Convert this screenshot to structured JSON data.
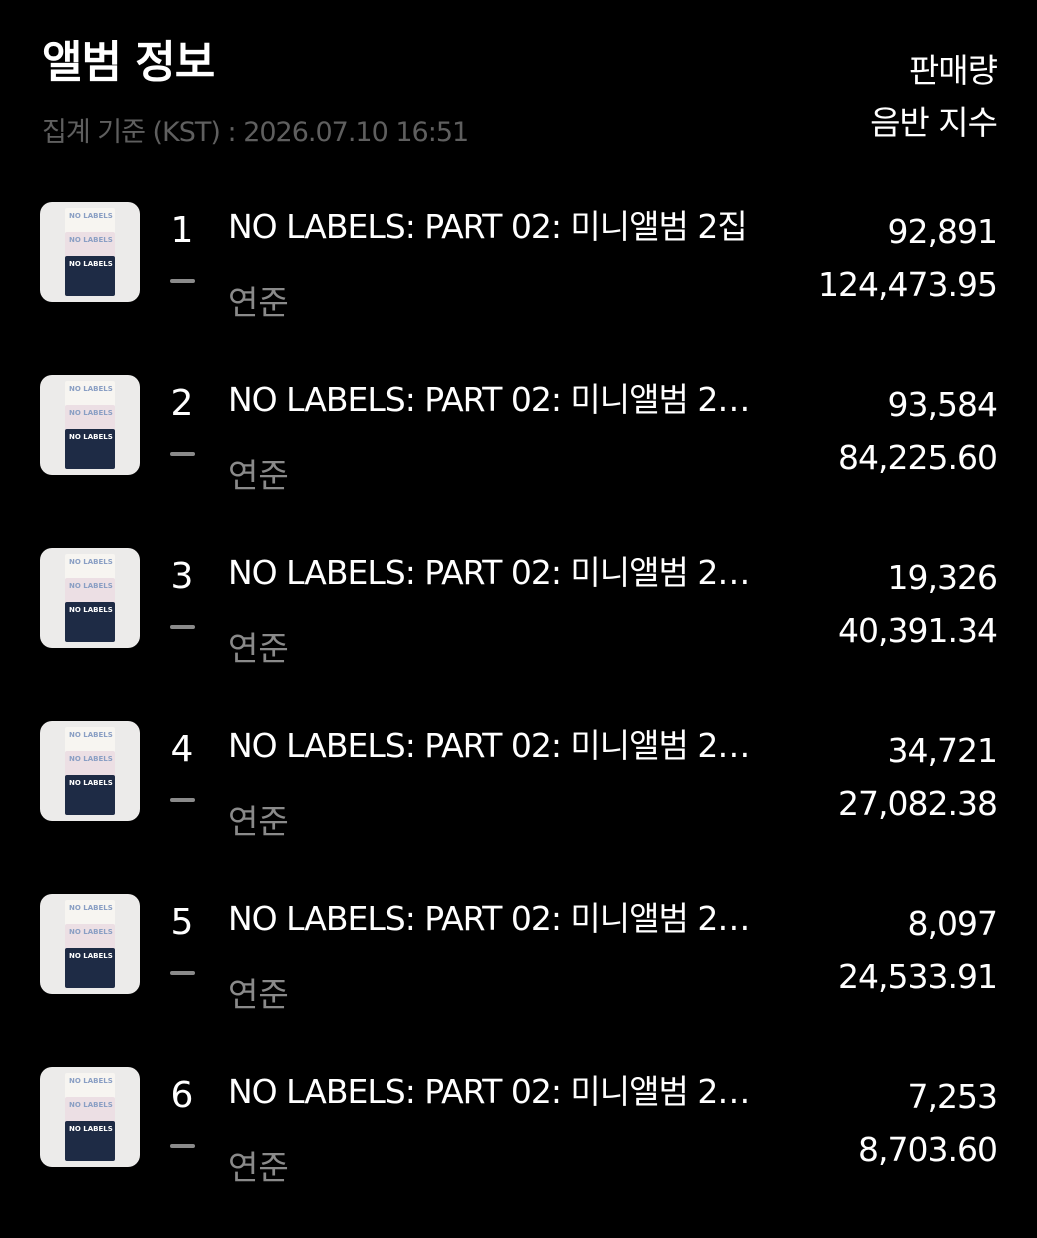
{
  "header": {
    "title": "앨범 정보",
    "updated_at": "집계 기준 (KST) : 2026.07.10 16:51",
    "col_sales": "판매량",
    "col_index": "음반 지수"
  },
  "rows": [
    {
      "rank": "1",
      "change_icon": "dash-icon",
      "title": "NO LABELS: PART 02: 미니앨범 2집",
      "artist": "연준",
      "sales": "92,891",
      "index": "124,473.95",
      "cover_text": "NO LABELS"
    },
    {
      "rank": "2",
      "change_icon": "dash-icon",
      "title": "NO LABELS: PART 02: 미니앨범 2…",
      "artist": "연준",
      "sales": "93,584",
      "index": "84,225.60",
      "cover_text": "NO LABELS"
    },
    {
      "rank": "3",
      "change_icon": "dash-icon",
      "title": "NO LABELS: PART 02: 미니앨범 2…",
      "artist": "연준",
      "sales": "19,326",
      "index": "40,391.34",
      "cover_text": "NO LABELS"
    },
    {
      "rank": "4",
      "change_icon": "dash-icon",
      "title": "NO LABELS: PART 02: 미니앨범 2…",
      "artist": "연준",
      "sales": "34,721",
      "index": "27,082.38",
      "cover_text": "NO LABELS"
    },
    {
      "rank": "5",
      "change_icon": "dash-icon",
      "title": "NO LABELS: PART 02: 미니앨범 2…",
      "artist": "연준",
      "sales": "8,097",
      "index": "24,533.91",
      "cover_text": "NO LABELS"
    },
    {
      "rank": "6",
      "change_icon": "dash-icon",
      "title": "NO LABELS: PART 02: 미니앨범 2…",
      "artist": "연준",
      "sales": "7,253",
      "index": "8,703.60",
      "cover_text": "NO LABELS"
    }
  ],
  "colors": {
    "background": "#000000",
    "primary_text": "#ffffff",
    "secondary_text": "#8a8a8a",
    "muted_text": "#5f5f5f"
  }
}
